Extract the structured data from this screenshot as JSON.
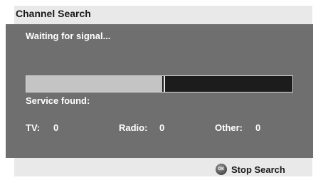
{
  "dialog": {
    "title": "Channel Search"
  },
  "status": {
    "message": "Waiting for signal...",
    "progress": 0.51
  },
  "service": {
    "heading": "Service found:",
    "counts": [
      {
        "label": "TV:",
        "value": "0"
      },
      {
        "label": "Radio:",
        "value": "0"
      },
      {
        "label": "Other:",
        "value": "0"
      }
    ]
  },
  "footer": {
    "ok_icon": "OK",
    "stop_label": "Stop Search"
  }
}
